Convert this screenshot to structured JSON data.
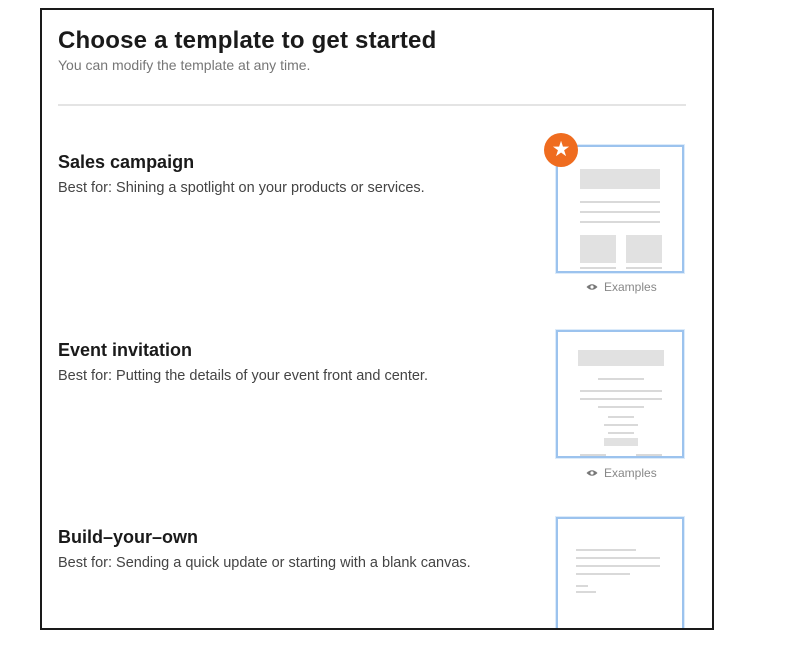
{
  "header": {
    "title": "Choose a template to get started",
    "subtitle": "You can modify the template at any time."
  },
  "templates": [
    {
      "name": "Sales campaign",
      "description": "Best for: Shining a spotlight on your products or services.",
      "examples_label": "Examples",
      "featured_icon": "star-icon"
    },
    {
      "name": "Event invitation",
      "description": "Best for: Putting the details of your event front and center.",
      "examples_label": "Examples"
    },
    {
      "name": "Build–your–own",
      "description": "Best for: Sending a quick update or starting with a blank canvas."
    }
  ],
  "colors": {
    "accent_badge": "#ef6c1f",
    "thumbnail_border": "#9cc3ee"
  }
}
